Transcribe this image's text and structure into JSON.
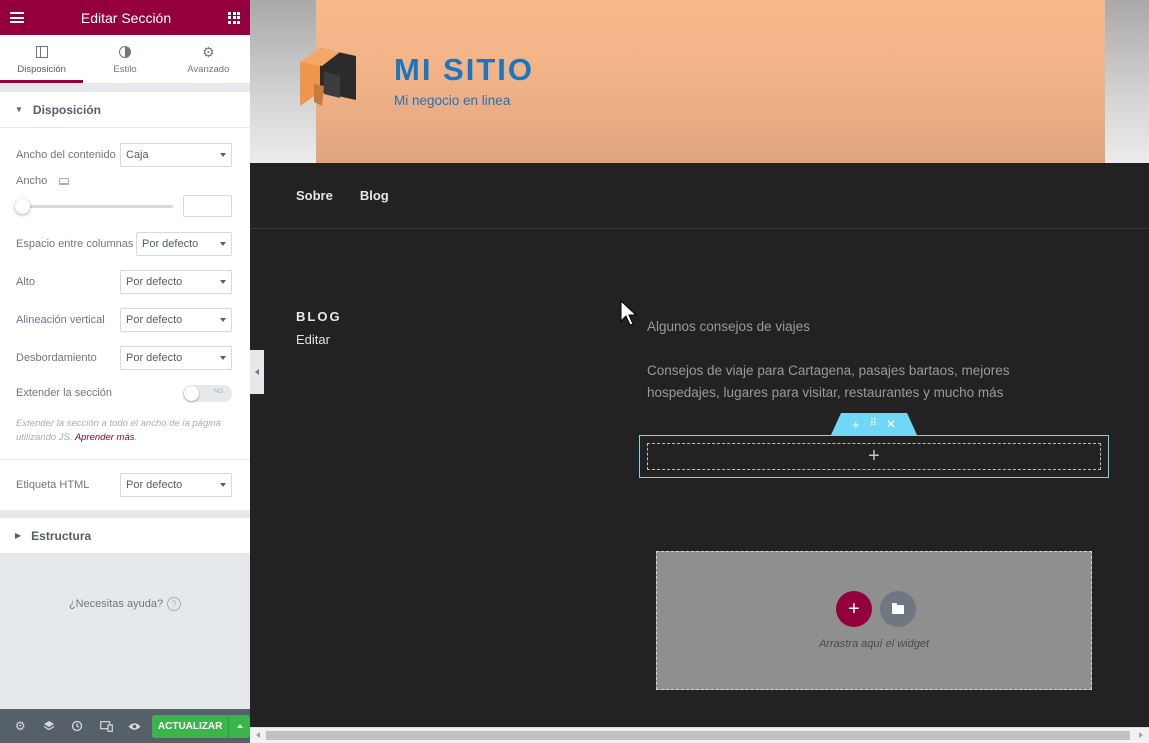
{
  "panel": {
    "title": "Editar Sección",
    "tabs": [
      {
        "label": "Disposición",
        "icon": "layout-icon",
        "active": true
      },
      {
        "label": "Estilo",
        "icon": "style-icon",
        "active": false
      },
      {
        "label": "Avanzado",
        "icon": "gear-icon",
        "active": false
      }
    ],
    "section_layout": "Disposición",
    "controls": {
      "content_width_label": "Ancho del contenido",
      "content_width_value": "Caja",
      "width_label": "Ancho",
      "column_gap_label": "Espacio entre columnas",
      "column_gap_value": "Por defecto",
      "height_label": "Alto",
      "height_value": "Por defecto",
      "vertical_align_label": "Alineación vertical",
      "vertical_align_value": "Por defecto",
      "overflow_label": "Desbordamiento",
      "overflow_value": "Por defecto",
      "stretch_label": "Extender la sección",
      "stretch_switch": "NO",
      "help_text": "Extender la sección a todo el ancho de la página utilizando JS.",
      "help_link": "Aprender más",
      "help_end": ".",
      "html_tag_label": "Etiqueta HTML",
      "html_tag_value": "Por defecto"
    },
    "section_structure": "Estructura",
    "need_help": "¿Necesitas ayuda?",
    "footer": {
      "update_label": "ACTUALIZAR"
    }
  },
  "site": {
    "title": "MI SITIO",
    "tagline": "Mi negocio en linea",
    "nav": [
      "Sobre",
      "Blog"
    ],
    "blog_title": "BLOG",
    "blog_edit": "Editar",
    "desc1": "Algunos consejos de viajes",
    "desc2": "Consejos de viaje para Cartagena, pasajes bartaos, mejores hospedajes, lugares para visitar, restaurantes y mucho más",
    "dropzone_text": "Arrastra aquí el widget"
  },
  "colors": {
    "brand": "#93003c",
    "update_green": "#39b54a",
    "section_handle": "#71d7f7",
    "site_title_blue": "#1b76c2"
  }
}
